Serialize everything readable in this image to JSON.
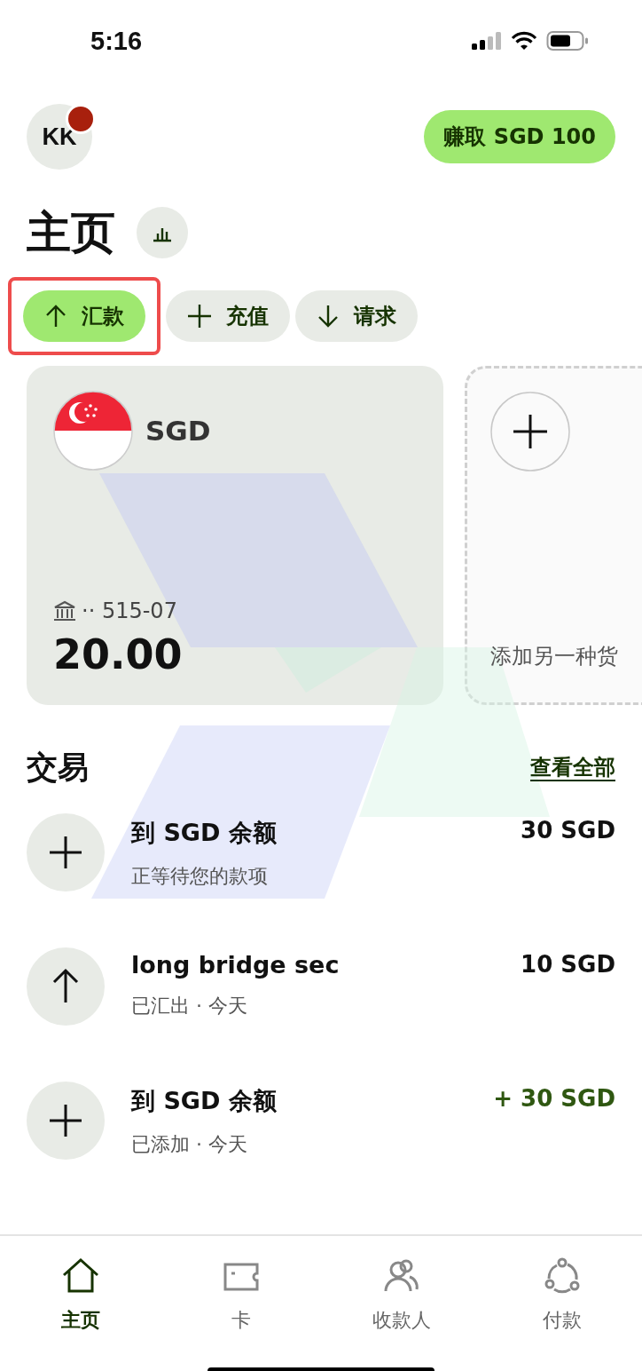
{
  "status_bar": {
    "time": "5:16"
  },
  "header": {
    "avatar": {
      "initials": "KK",
      "notification": true
    },
    "earn_button": "赚取 SGD 100"
  },
  "title": "主页",
  "actions": [
    {
      "kind": "send",
      "label": "汇款",
      "primary": true,
      "highlighted": true
    },
    {
      "kind": "topup",
      "label": "充值",
      "primary": false,
      "highlighted": false
    },
    {
      "kind": "request",
      "label": "请求",
      "primary": false,
      "highlighted": false
    }
  ],
  "balances": [
    {
      "kind": "currency",
      "currency": "SGD",
      "account": "·· 515-07",
      "amount": "20.00"
    },
    {
      "kind": "add",
      "label": "添加另一种货"
    }
  ],
  "transactions": {
    "title": "交易",
    "link": "查看全部",
    "items": [
      {
        "kind": "add",
        "title": "到 SGD 余额",
        "subtitle": "正等待您的款项",
        "amount": "30 SGD",
        "positive": false
      },
      {
        "kind": "send",
        "title": "long bridge sec",
        "subtitle": "已汇出 · 今天",
        "amount": "10 SGD",
        "positive": false
      },
      {
        "kind": "add",
        "title": "到 SGD 余额",
        "subtitle": "已添加 · 今天",
        "amount": "+ 30 SGD",
        "positive": true
      }
    ]
  },
  "nav": [
    {
      "label": "主页",
      "selected": true
    },
    {
      "label": "卡",
      "selected": false
    },
    {
      "label": "收款人",
      "selected": false
    },
    {
      "label": "付款",
      "selected": false
    }
  ]
}
